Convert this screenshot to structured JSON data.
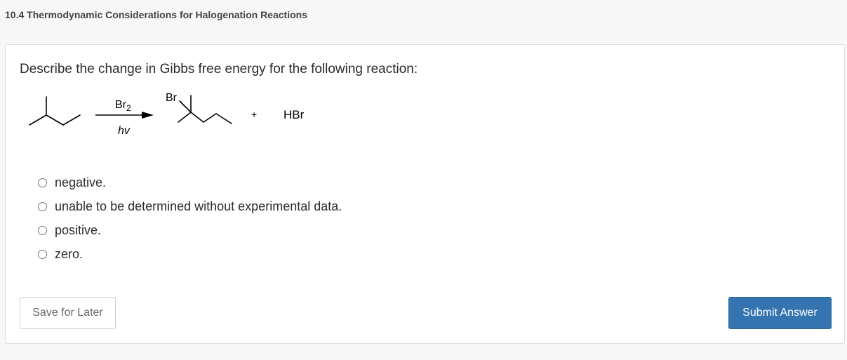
{
  "page": {
    "title": "10.4 Thermodynamic Considerations for Halogenation Reactions"
  },
  "question": {
    "prompt": "Describe the change in Gibbs free energy for the following reaction:",
    "reaction": {
      "reagent_main": "Br",
      "reagent_subscript": "2",
      "condition": "hv",
      "product_substituent": "Br",
      "plus": "+",
      "byproduct": "HBr"
    }
  },
  "choices": [
    {
      "label": "negative.",
      "selected": false
    },
    {
      "label": "unable to be determined without experimental data.",
      "selected": false
    },
    {
      "label": "positive.",
      "selected": false
    },
    {
      "label": "zero.",
      "selected": false
    }
  ],
  "buttons": {
    "save_label": "Save for Later",
    "submit_label": "Submit Answer"
  },
  "colors": {
    "submit_bg": "#3474b0",
    "page_bg": "#f7f7f7"
  }
}
